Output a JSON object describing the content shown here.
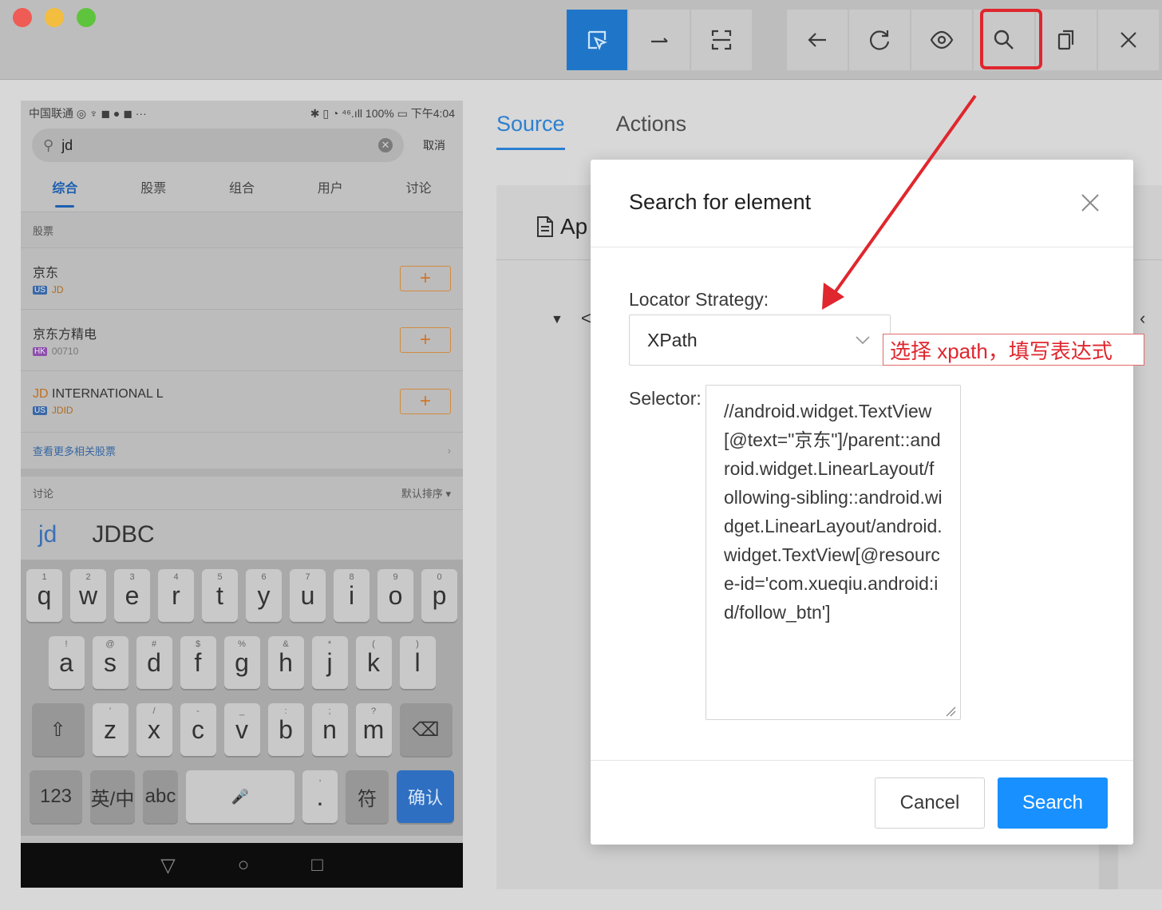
{
  "toolbar": {
    "left_group": [
      {
        "name": "select-element-mode",
        "icon": "select-icon",
        "active": true
      },
      {
        "name": "swipe-mode",
        "icon": "swipe-arrow-icon",
        "active": false
      },
      {
        "name": "tap-coordinates-mode",
        "icon": "crop-icon",
        "active": false
      }
    ],
    "right_group": [
      {
        "name": "back",
        "icon": "back-arrow-icon"
      },
      {
        "name": "refresh",
        "icon": "refresh-icon"
      },
      {
        "name": "toggle-visibility",
        "icon": "eye-icon"
      },
      {
        "name": "search-element",
        "icon": "search-icon",
        "highlighted": true
      },
      {
        "name": "copy-xml",
        "icon": "copy-icon"
      },
      {
        "name": "quit-session",
        "icon": "close-icon"
      }
    ]
  },
  "phone": {
    "status_left": "中国联通 ◎ ♆ ◼ ● ◼ ···",
    "status_right": "✱ ▯ ◔ ⁴⁶.ıll 100% ▭ 下午4:04",
    "search_value": "jd",
    "cancel_label": "取消",
    "tabs": [
      {
        "label": "综合",
        "active": true
      },
      {
        "label": "股票",
        "active": false
      },
      {
        "label": "组合",
        "active": false
      },
      {
        "label": "用户",
        "active": false
      },
      {
        "label": "讨论",
        "active": false
      }
    ],
    "stocks_section_label": "股票",
    "stocks": [
      {
        "name": "京东",
        "market": "US",
        "code": "JD"
      },
      {
        "name": "京东方精电",
        "market": "HK",
        "code": "00710"
      },
      {
        "name_prefix": "JD",
        "name": " INTERNATIONAL L",
        "market": "US",
        "code": "JDID"
      }
    ],
    "add_symbol": "+",
    "more_label": "查看更多相关股票",
    "discussion_label": "讨论",
    "sort_label": "默认排序 ▾",
    "suggestions": [
      "jd",
      "JDBC"
    ],
    "keyboard": {
      "row1": [
        {
          "k": "q",
          "h": "1"
        },
        {
          "k": "w",
          "h": "2"
        },
        {
          "k": "e",
          "h": "3"
        },
        {
          "k": "r",
          "h": "4"
        },
        {
          "k": "t",
          "h": "5"
        },
        {
          "k": "y",
          "h": "6"
        },
        {
          "k": "u",
          "h": "7"
        },
        {
          "k": "i",
          "h": "8"
        },
        {
          "k": "o",
          "h": "9"
        },
        {
          "k": "p",
          "h": "0"
        }
      ],
      "row2": [
        {
          "k": "a",
          "h": "!"
        },
        {
          "k": "s",
          "h": "@"
        },
        {
          "k": "d",
          "h": "#"
        },
        {
          "k": "f",
          "h": "$"
        },
        {
          "k": "g",
          "h": "%"
        },
        {
          "k": "h",
          "h": "&"
        },
        {
          "k": "j",
          "h": "*"
        },
        {
          "k": "k",
          "h": "("
        },
        {
          "k": "l",
          "h": ")"
        }
      ],
      "row3": [
        {
          "k": "z",
          "h": "'"
        },
        {
          "k": "x",
          "h": "/"
        },
        {
          "k": "c",
          "h": "-"
        },
        {
          "k": "v",
          "h": "_"
        },
        {
          "k": "b",
          "h": ":"
        },
        {
          "k": "n",
          "h": ";"
        },
        {
          "k": "m",
          "h": "?"
        }
      ],
      "shift_symbol": "⇧",
      "delete_symbol": "⌫",
      "num_label": "123",
      "lang_label": "英/中",
      "abc_label": "abc",
      "mic_symbol": "🎤",
      "period_label": ".",
      "period_hint": ",",
      "symbol_label": "符",
      "confirm_label": "确认"
    },
    "nav": [
      "▽",
      "○",
      "□"
    ]
  },
  "right_panel": {
    "tabs": [
      {
        "label": "Source",
        "active": true
      },
      {
        "label": "Actions",
        "active": false
      }
    ],
    "header_partial": "Ap",
    "tree_caret": "▼",
    "tree_partial": "<",
    "right_caret": "‹"
  },
  "modal": {
    "title": "Search for element",
    "locator_label": "Locator Strategy:",
    "locator_value": "XPath",
    "selector_label": "Selector:",
    "selector_value": "//android.widget.TextView[@text=\"京东\"]/parent::android.widget.LinearLayout/following-sibling::android.widget.LinearLayout/android.widget.TextView[@resource-id='com.xueqiu.android:id/follow_btn']",
    "cancel_label": "Cancel",
    "search_label": "Search"
  },
  "annotation": {
    "text": "选择 xpath，填写表达式",
    "color": "#e0262e"
  },
  "colors": {
    "accent": "#1890ff",
    "active_toolbar": "#1f76c9",
    "annotation_red": "#e0262e"
  }
}
